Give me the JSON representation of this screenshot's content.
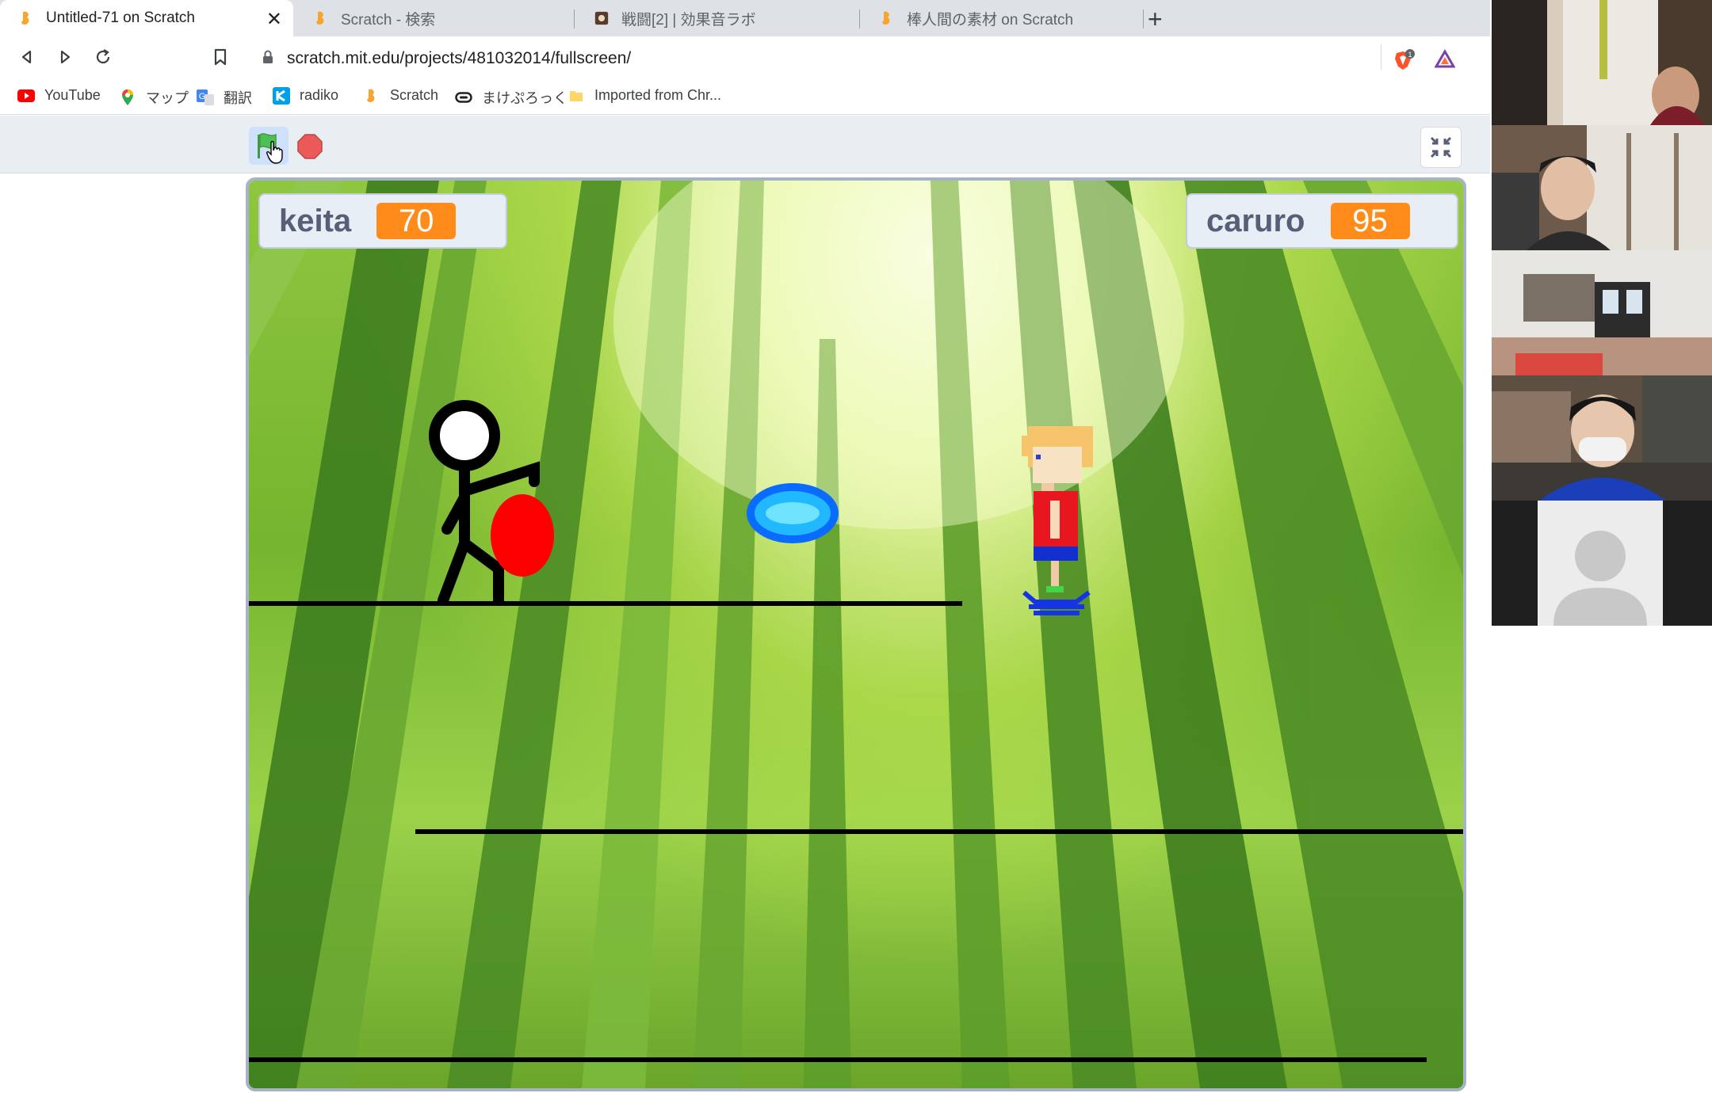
{
  "tabs": [
    {
      "title": "Untitled-71 on Scratch",
      "active": true
    },
    {
      "title": "Scratch - 検索",
      "active": false
    },
    {
      "title": "戦闘[2] | 効果音ラボ",
      "active": false
    },
    {
      "title": "棒人間の素材 on Scratch",
      "active": false
    }
  ],
  "new_tab": "+",
  "close_tab": "✕",
  "address": {
    "url": "scratch.mit.edu/projects/481032014/fullscreen/"
  },
  "extensions": {
    "brave_badge": "1"
  },
  "bookmarks": [
    {
      "label": "YouTube",
      "icon": "youtube-icon"
    },
    {
      "label": "マップ",
      "icon": "maps-icon"
    },
    {
      "label": "翻訳",
      "icon": "translate-icon"
    },
    {
      "label": "radiko",
      "icon": "radiko-icon"
    },
    {
      "label": "Scratch",
      "icon": "scratch-icon"
    },
    {
      "label": "まけぷろっく",
      "icon": "link-icon"
    },
    {
      "label": "Imported from Chr...",
      "icon": "folder-icon"
    }
  ],
  "stage": {
    "monitors": [
      {
        "label": "keita",
        "value": "70"
      },
      {
        "label": "caruro",
        "value": "95"
      }
    ]
  },
  "colors": {
    "monitor_value": "#ff8c1a",
    "monitor_label": "#575e75",
    "flag_green": "#4cbf56",
    "stop_red": "#ec5959"
  },
  "video_tiles": [
    "participant-1",
    "participant-2",
    "participant-3",
    "participant-4",
    "participant-5"
  ]
}
